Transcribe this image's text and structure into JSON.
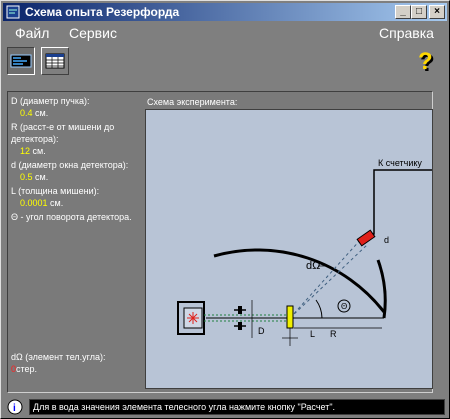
{
  "window": {
    "title": "Схема опыта Резерфорда"
  },
  "window_buttons": {
    "minimize": "_",
    "maximize": "□",
    "close": "×"
  },
  "menu": {
    "file": "Файл",
    "service": "Сервис",
    "help": "Справка"
  },
  "toolbar": {
    "buttons": [
      "scheme-view-icon",
      "table-view-icon"
    ],
    "help_icon": "question-icon"
  },
  "params": {
    "D": {
      "label": "D (диаметр пучка):",
      "value": "0.4",
      "unit": "см."
    },
    "R": {
      "label": "R (расст-е от мишени до детектора):",
      "value": "12",
      "unit": "см."
    },
    "d": {
      "label": "d (диаметр окна детектора):",
      "value": "0.5",
      "unit": "см."
    },
    "L": {
      "label": "L (толщина мишени):",
      "value": "0.0001",
      "unit": "см."
    },
    "theta": {
      "label": "Θ - угол поворота детектора."
    }
  },
  "solid_angle": {
    "label": "dΩ (элемент тел.угла):",
    "value": "0",
    "unit": "стер."
  },
  "scheme": {
    "title": "Схема эксперимента:",
    "labels": {
      "counter": "К счетчику",
      "d": "d",
      "dOmega": "dΩ",
      "theta": "Θ",
      "D": "D",
      "L": "L",
      "R": "R"
    }
  },
  "status": {
    "text": "Для в вода значения элемента телесного угла нажмите кнопку \"Расчет\"."
  },
  "colors": {
    "value": "#ffff00",
    "titlebar_start": "#0a246a",
    "titlebar_end": "#a6caf0",
    "scheme_bg": "#b8c4d6",
    "detector": "#e0201a"
  }
}
